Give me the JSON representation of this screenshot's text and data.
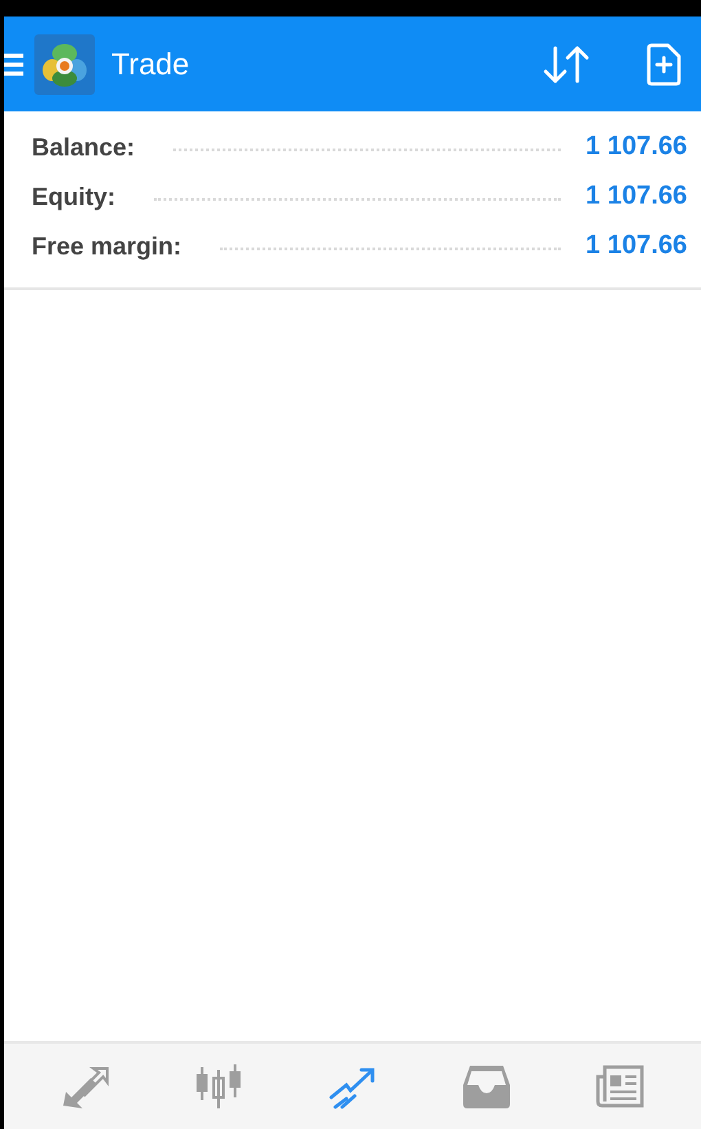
{
  "app_bar": {
    "title": "Trade"
  },
  "summary": [
    {
      "label": "Balance:",
      "value": "1 107.66"
    },
    {
      "label": "Equity:",
      "value": "1 107.66"
    },
    {
      "label": "Free margin:",
      "value": "1 107.66"
    }
  ],
  "bottom_nav": [
    {
      "kind": "quotes",
      "selected": false
    },
    {
      "kind": "chart",
      "selected": false
    },
    {
      "kind": "trade",
      "selected": true
    },
    {
      "kind": "history",
      "selected": false
    },
    {
      "kind": "news",
      "selected": false
    }
  ]
}
